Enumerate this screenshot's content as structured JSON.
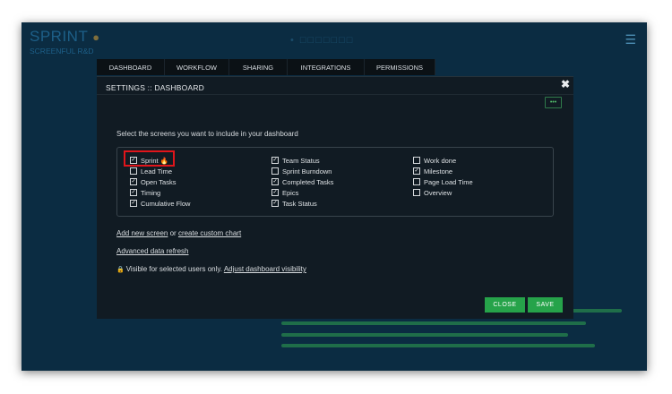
{
  "app": {
    "logo_title": "SPRINT",
    "logo_subtitle": "SCREENFUL R&D",
    "center_title": "• □□□□□□□",
    "menu_icon": "hamburger-icon"
  },
  "tabs": [
    {
      "label": "DASHBOARD"
    },
    {
      "label": "WORKFLOW"
    },
    {
      "label": "SHARING"
    },
    {
      "label": "INTEGRATIONS"
    },
    {
      "label": "PERMISSIONS"
    }
  ],
  "modal": {
    "title": "SETTINGS :: DASHBOARD",
    "more_label": "•••",
    "instructions": "Select the screens you want to include in your dashboard",
    "columns": [
      [
        {
          "label": "Sprint",
          "checked": true,
          "highlighted": true,
          "icon": "flame-icon"
        },
        {
          "label": "Lead Time",
          "checked": false
        },
        {
          "label": "Open Tasks",
          "checked": true
        },
        {
          "label": "Timing",
          "checked": true
        },
        {
          "label": "Cumulative Flow",
          "checked": true
        }
      ],
      [
        {
          "label": "Team Status",
          "checked": true
        },
        {
          "label": "Sprint Burndown",
          "checked": false
        },
        {
          "label": "Completed Tasks",
          "checked": true
        },
        {
          "label": "Epics",
          "checked": true
        },
        {
          "label": "Task Status",
          "checked": true
        }
      ],
      [
        {
          "label": "Work done",
          "checked": false
        },
        {
          "label": "Milestone",
          "checked": true
        },
        {
          "label": "Page Load Time",
          "checked": false
        },
        {
          "label": "Overview",
          "checked": false
        }
      ]
    ],
    "add_screen_link": "Add new screen",
    "or_text": " or ",
    "custom_chart_link": "create custom chart",
    "advanced_refresh_link": "Advanced data refresh",
    "visibility_text": "Visible for selected users only.",
    "visibility_link": "Adjust dashboard visibility",
    "close_label": "CLOSE",
    "save_label": "SAVE"
  },
  "colors": {
    "background": "#0b2c42",
    "modal": "#111b23",
    "accent_green": "#26a34a",
    "highlight_red": "#e0151b"
  }
}
